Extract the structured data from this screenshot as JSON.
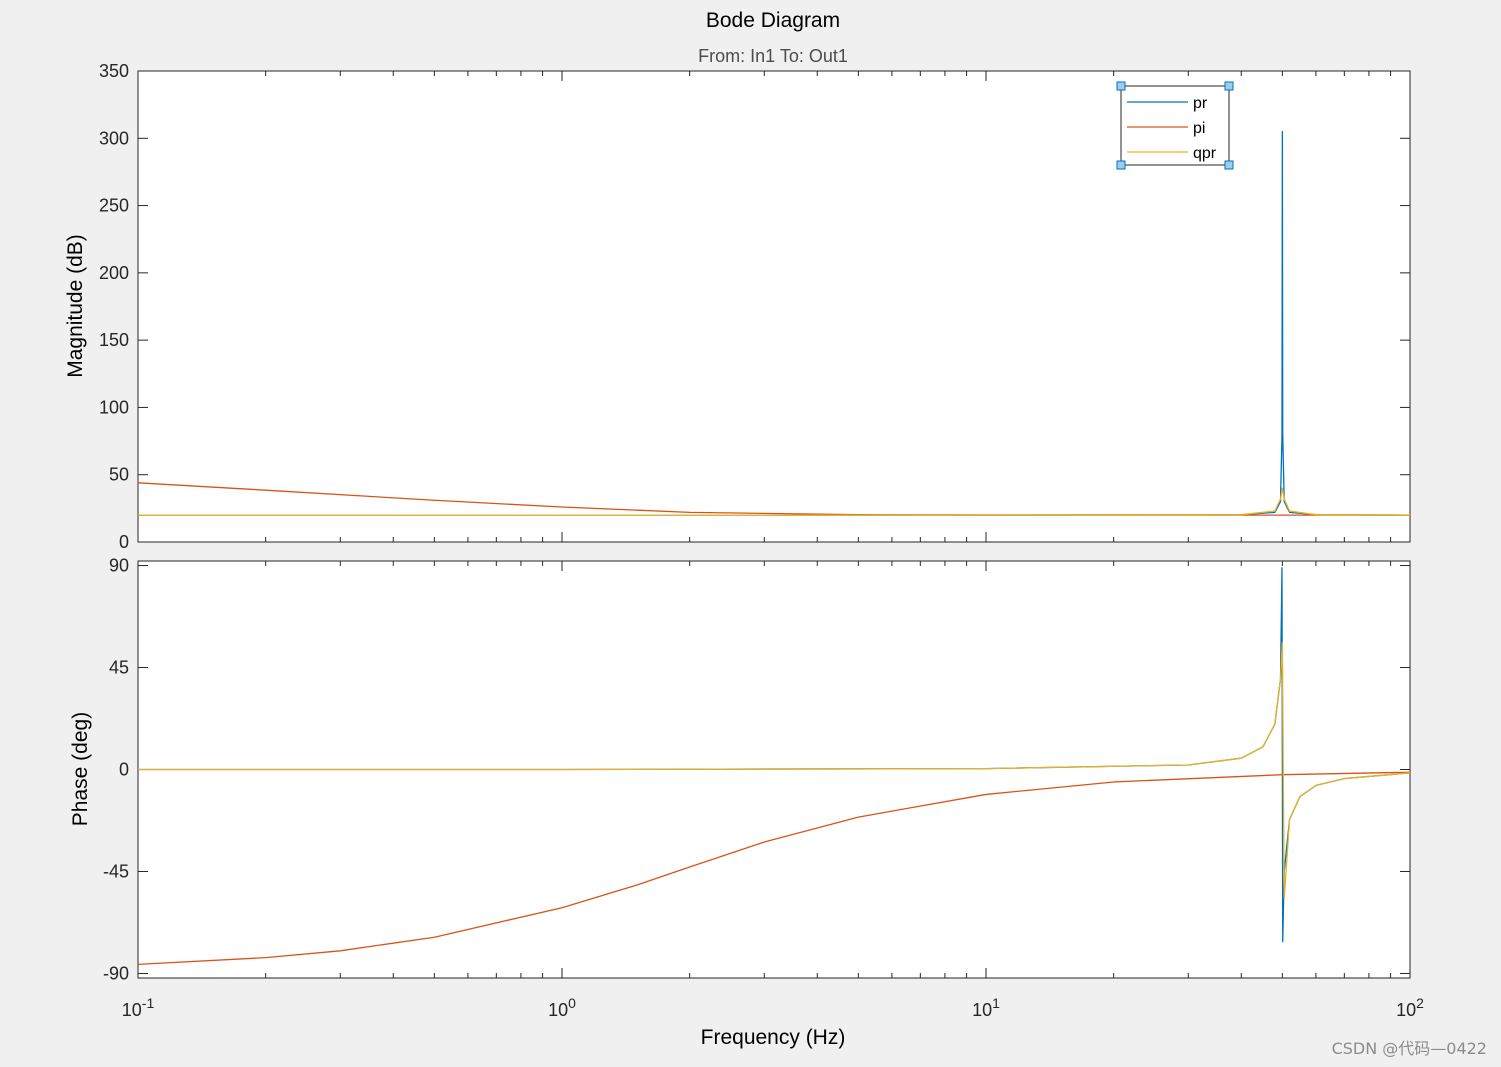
{
  "figure": {
    "title": "Bode Diagram",
    "subtitle": "From: In1  To: Out1",
    "watermark": "CSDN @代码—0422"
  },
  "chart_data": [
    {
      "type": "line",
      "panel": "magnitude",
      "ylabel": "Magnitude (dB)",
      "xscale": "log",
      "xlim": [
        0.1,
        100
      ],
      "ylim": [
        0,
        350
      ],
      "yticks": [
        0,
        50,
        100,
        150,
        200,
        250,
        300,
        350
      ],
      "grid": false,
      "legend_position": "top-right",
      "series": [
        {
          "name": "pr",
          "color": "#0072bd",
          "x": [
            0.1,
            1,
            10,
            40,
            48,
            49.5,
            49.9,
            50,
            50.1,
            50.5,
            52,
            60,
            100
          ],
          "y": [
            20,
            20,
            20,
            20.3,
            22,
            30,
            80,
            305,
            80,
            30,
            22,
            20.3,
            20
          ]
        },
        {
          "name": "pi",
          "color": "#d95319",
          "x": [
            0.1,
            0.2,
            0.5,
            1,
            2,
            5,
            10,
            20,
            50,
            100
          ],
          "y": [
            44,
            38.5,
            31,
            26,
            22,
            20.3,
            20.1,
            20.0,
            20.0,
            20.0
          ]
        },
        {
          "name": "qpr",
          "color": "#edb120",
          "x": [
            0.1,
            1,
            10,
            40,
            48,
            49.5,
            50,
            50.5,
            52,
            60,
            100
          ],
          "y": [
            20,
            20,
            20,
            20.3,
            23,
            32,
            40,
            32,
            23,
            20.3,
            20
          ]
        }
      ]
    },
    {
      "type": "line",
      "panel": "phase",
      "xlabel": "Frequency  (Hz)",
      "ylabel": "Phase (deg)",
      "xscale": "log",
      "xlim": [
        0.1,
        100
      ],
      "ylim": [
        -92,
        92
      ],
      "yticks": [
        -90,
        -45,
        0,
        45,
        90
      ],
      "xticks": [
        0.1,
        1,
        10,
        100
      ],
      "xtick_labels": [
        {
          "base": "10",
          "exp": "-1"
        },
        {
          "base": "10",
          "exp": "0"
        },
        {
          "base": "10",
          "exp": "1"
        },
        {
          "base": "10",
          "exp": "2"
        }
      ],
      "grid": false,
      "series": [
        {
          "name": "pr",
          "color": "#0072bd",
          "x": [
            0.1,
            1,
            10,
            30,
            40,
            45,
            48,
            49.5,
            49.9,
            50,
            50.1,
            50.5,
            52,
            55,
            60,
            70,
            100
          ],
          "y": [
            0,
            0,
            0.4,
            2,
            5,
            10,
            20,
            40,
            89,
            0,
            -76,
            -45,
            -22,
            -12,
            -7,
            -4,
            -1.5
          ]
        },
        {
          "name": "pi",
          "color": "#d95319",
          "x": [
            0.1,
            0.2,
            0.3,
            0.5,
            1,
            1.5,
            2,
            3,
            5,
            10,
            20,
            50,
            100
          ],
          "y": [
            -86,
            -83,
            -80,
            -74,
            -61,
            -51,
            -43,
            -32,
            -21,
            -11,
            -5.5,
            -2.3,
            -1.2
          ]
        },
        {
          "name": "qpr",
          "color": "#edb120",
          "x": [
            0.1,
            1,
            10,
            30,
            40,
            45,
            48,
            49.5,
            50,
            50.5,
            52,
            55,
            60,
            70,
            100
          ],
          "y": [
            0,
            0,
            0.4,
            2,
            5,
            10,
            20,
            40,
            56,
            -57,
            -22,
            -12,
            -7,
            -4,
            -1.5
          ]
        }
      ]
    }
  ]
}
